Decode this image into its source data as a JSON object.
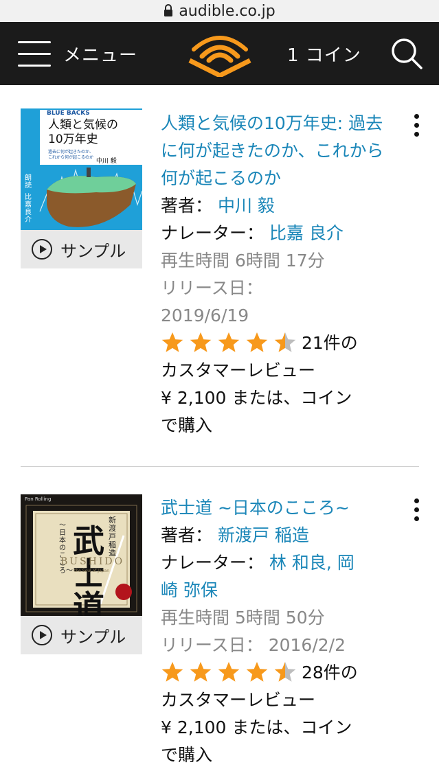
{
  "browser": {
    "url": "audible.co.jp",
    "lock_icon": "lock-icon"
  },
  "nav": {
    "menu_label": "メニュー",
    "coins_label": "1 コイン",
    "logo_icon": "audible-logo-icon",
    "search_icon": "search-icon",
    "accent_color": "#f7991c"
  },
  "items": [
    {
      "cover": {
        "series": "BLUE BACKS",
        "title_line1": "人類と気候の",
        "title_line2": "10万年史",
        "subtitle1": "過去に何が起きたのか、",
        "subtitle2": "これから何が起こるのか",
        "author": "中川 毅",
        "reader_label": "朗読",
        "reader": "比嘉良介"
      },
      "sample_label": "サンプル",
      "title": "人類と気候の10万年史: 過去に何が起きたのか、これから何が起こるのか",
      "author_label": "著者：",
      "author": "中川 毅",
      "narrator_label": "ナレーター：",
      "narrators": "比嘉 良介",
      "duration": "再生時間 6時間 17分",
      "release_label": "リリース日：",
      "release_date": "2019/6/19",
      "rating": 4.5,
      "review_count": "21件の",
      "review_label": "カスタマーレビュー",
      "price": "¥ 2,100 または、コイン",
      "price_suffix": "で購入"
    },
    {
      "cover": {
        "publisher": "Pan Rolling",
        "title": "武士道",
        "subtitle": "〜日本のこころ〜",
        "author": "新渡戸 稲造",
        "latin": "BUSHIDO",
        "latin_sub": "the Soul of Japan"
      },
      "sample_label": "サンプル",
      "title": "武士道 ~日本のこころ~",
      "author_label": "著者：",
      "author": "新渡戸 稲造",
      "narrator_label": "ナレーター：",
      "narrators_line1": "林 和良, 岡",
      "narrators_line2": "崎 弥保",
      "duration": "再生時間 5時間 50分",
      "release_label": "リリース日：",
      "release_date": "2016/2/2",
      "rating": 4.5,
      "review_count": "28件の",
      "review_label": "カスタマーレビュー",
      "price": "¥ 2,100 または、コイン",
      "price_suffix": "で購入"
    }
  ],
  "more_icon": "more-vertical-icon",
  "play_icon": "play-circle-icon",
  "star_color": "#f7991c",
  "star_empty_color": "#bdbdbd"
}
